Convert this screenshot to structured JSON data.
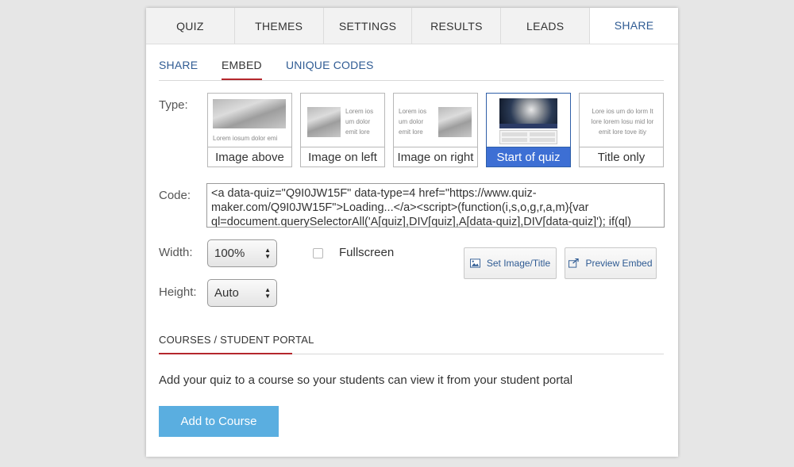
{
  "tabs": [
    {
      "label": "QUIZ"
    },
    {
      "label": "THEMES"
    },
    {
      "label": "SETTINGS"
    },
    {
      "label": "RESULTS"
    },
    {
      "label": "LEADS"
    },
    {
      "label": "SHARE",
      "active": true
    }
  ],
  "subtabs": [
    {
      "label": "SHARE"
    },
    {
      "label": "EMBED",
      "active": true
    },
    {
      "label": "UNIQUE CODES"
    }
  ],
  "labels": {
    "type": "Type:",
    "code": "Code:",
    "width": "Width:",
    "height": "Height:",
    "fullscreen": "Fullscreen"
  },
  "type_options": [
    {
      "label": "Image above",
      "lorem": "Lorem iosum dolor emi"
    },
    {
      "label": "Image on left",
      "lorem": "Lorem ios um dolor emit lore"
    },
    {
      "label": "Image on right",
      "lorem": "Lorem ios um dolor emit lore"
    },
    {
      "label": "Start of quiz",
      "selected": true
    },
    {
      "label": "Title only",
      "lorem": "Lore ios um do lorm It lore lorem losu mid lor emit lore tove itiy"
    }
  ],
  "code": "<a data-quiz=\"Q9I0JW15F\" data-type=4 href=\"https://www.quiz-maker.com/Q9I0JW15F\">Loading...</a><script>(function(i,s,o,g,r,a,m){var ql=document.querySelectorAll('A[quiz],DIV[quiz],A[data-quiz],DIV[data-quiz]'); if(ql)",
  "width_value": "100%",
  "height_value": "Auto",
  "buttons": {
    "set_image_title": "Set Image/Title",
    "preview_embed": "Preview Embed"
  },
  "courses": {
    "title": "COURSES / STUDENT PORTAL",
    "description": "Add your quiz to a course so your students can view it from your student portal",
    "add_button": "Add to Course"
  },
  "colors": {
    "accent_blue": "#2f5b93",
    "selected_blue": "#3d6fd4",
    "primary_button": "#5aaee0",
    "underline_red": "#b5272d"
  }
}
